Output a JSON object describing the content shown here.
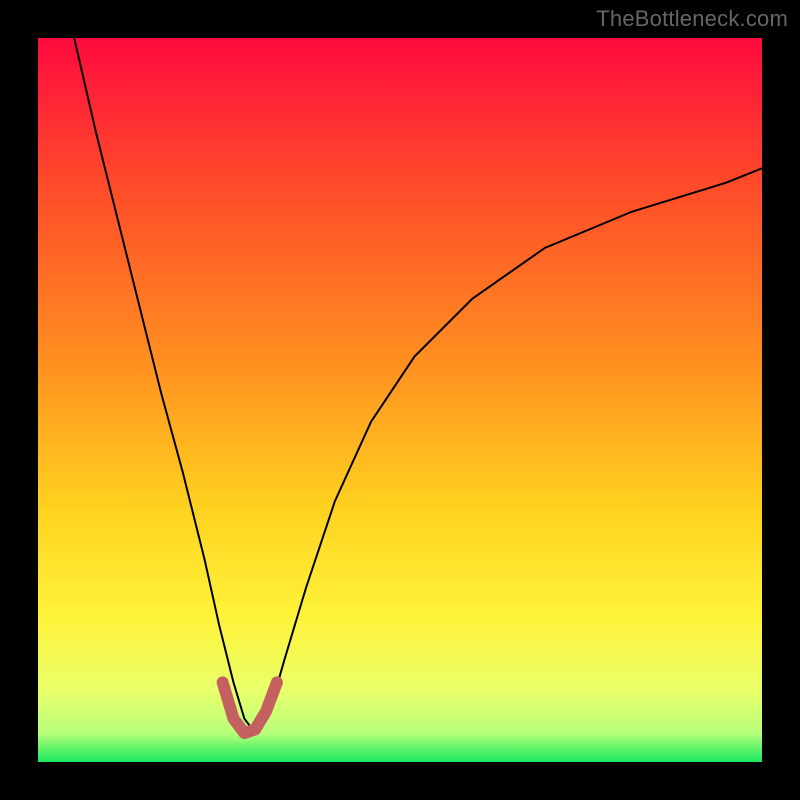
{
  "watermark": "TheBottleneck.com",
  "chart_data": {
    "type": "line",
    "title": "",
    "xlabel": "",
    "ylabel": "",
    "xlim": [
      0,
      100
    ],
    "ylim": [
      0,
      100
    ],
    "grid": false,
    "gradient_stops": [
      {
        "offset": 0.0,
        "color": "#ff0a3f"
      },
      {
        "offset": 0.2,
        "color": "#ff4a2a"
      },
      {
        "offset": 0.45,
        "color": "#ff9020"
      },
      {
        "offset": 0.65,
        "color": "#ffd21f"
      },
      {
        "offset": 0.8,
        "color": "#fff33a"
      },
      {
        "offset": 0.9,
        "color": "#eaff6a"
      },
      {
        "offset": 0.96,
        "color": "#b7ff7a"
      },
      {
        "offset": 1.0,
        "color": "#18e85e"
      }
    ],
    "series": [
      {
        "name": "curve",
        "stroke": "#000000",
        "stroke_width": 2,
        "x": [
          5,
          8,
          11,
          14,
          17,
          20,
          23,
          25,
          27,
          28.5,
          30,
          32,
          34,
          37,
          41,
          46,
          52,
          60,
          70,
          82,
          95,
          100
        ],
        "y": [
          100,
          87,
          75,
          63,
          51,
          40,
          28,
          19,
          11,
          6,
          4,
          7,
          14,
          24,
          36,
          47,
          56,
          64,
          71,
          76,
          80,
          82
        ]
      },
      {
        "name": "highlight",
        "stroke": "#c46060",
        "stroke_width": 12,
        "linecap": "round",
        "x": [
          25.5,
          27,
          28.5,
          30,
          31.5,
          33
        ],
        "y": [
          11,
          6,
          4,
          4.5,
          7,
          11
        ]
      }
    ]
  }
}
